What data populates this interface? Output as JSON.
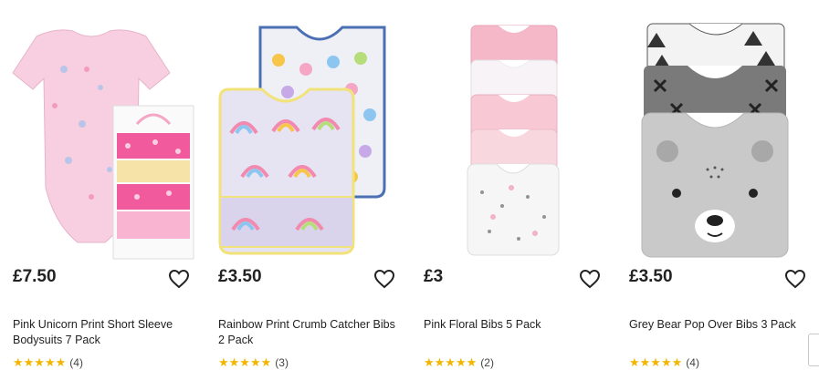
{
  "products": [
    {
      "price": "£7.50",
      "title": "Pink Unicorn Print Short Sleeve Bodysuits 7 Pack",
      "stars": "★★★★★",
      "count": "(4)",
      "wishlist_icon": "heart-outline-icon"
    },
    {
      "price": "£3.50",
      "title": "Rainbow Print Crumb Catcher Bibs 2 Pack",
      "stars": "★★★★★",
      "count": "(3)",
      "wishlist_icon": "heart-outline-icon"
    },
    {
      "price": "£3",
      "title": "Pink Floral Bibs 5 Pack",
      "stars": "★★★★★",
      "count": "(2)",
      "wishlist_icon": "heart-outline-icon"
    },
    {
      "price": "£3.50",
      "title": "Grey Bear Pop Over Bibs 3 Pack",
      "stars": "★★★★★",
      "count": "(4)",
      "wishlist_icon": "heart-outline-icon"
    }
  ],
  "colors": {
    "star": "#f2b600",
    "text": "#222222"
  }
}
